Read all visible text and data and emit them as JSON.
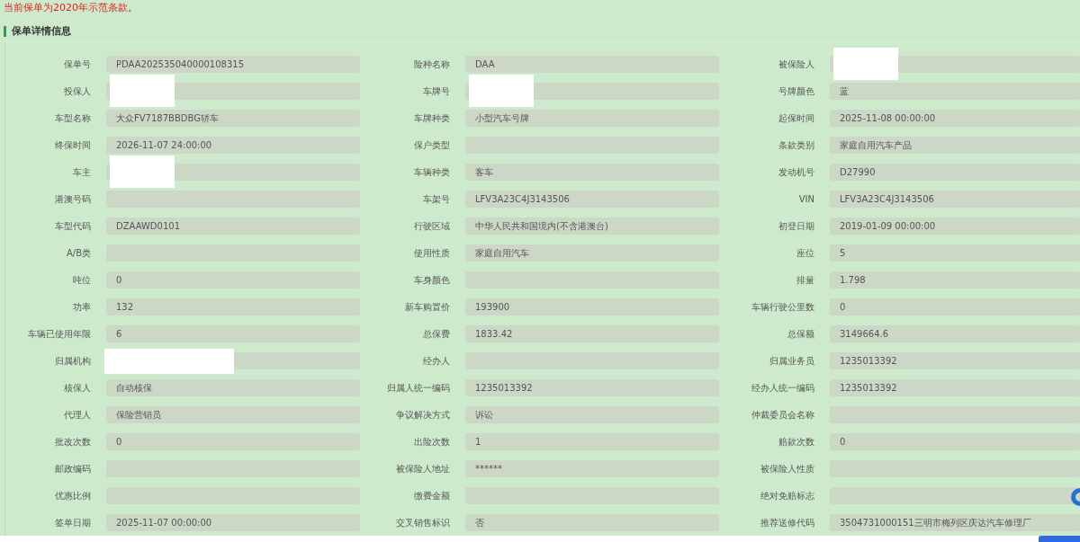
{
  "notice": "当前保单为2020年示范条款。",
  "section_title": "保单详情信息",
  "fields": [
    {
      "label": "保单号",
      "value": "PDAA202535040000108315"
    },
    {
      "label": "险种名称",
      "value": "DAA"
    },
    {
      "label": "被保险人",
      "redacted": true,
      "kind": "narrow"
    },
    {
      "label": "投保人",
      "redacted": true,
      "kind": "narrow"
    },
    {
      "label": "车牌号",
      "redacted": true,
      "kind": "narrow"
    },
    {
      "label": "号牌颜色",
      "value": "蓝"
    },
    {
      "label": "车型名称",
      "value": "大众FV7187BBDBG轿车"
    },
    {
      "label": "车牌种类",
      "value": "小型汽车号牌"
    },
    {
      "label": "起保时间",
      "value": "2025-11-08 00:00:00"
    },
    {
      "label": "终保时间",
      "value": "2026-11-07 24:00:00"
    },
    {
      "label": "保户类型"
    },
    {
      "label": "条款类别",
      "value": "家庭自用汽车产品"
    },
    {
      "label": "车主",
      "redacted": true,
      "kind": "narrow"
    },
    {
      "label": "车辆种类",
      "value": "客车"
    },
    {
      "label": "发动机号",
      "value": "D27990"
    },
    {
      "label": "港澳号码"
    },
    {
      "label": "车架号",
      "value": "LFV3A23C4J3143506"
    },
    {
      "label": "VIN",
      "value": "LFV3A23C4J3143506"
    },
    {
      "label": "车型代码",
      "value": "DZAAWD0101"
    },
    {
      "label": "行驶区域",
      "value": "中华人民共和国境内(不含港澳台)"
    },
    {
      "label": "初登日期",
      "value": "2019-01-09 00:00:00"
    },
    {
      "label": "A/B类"
    },
    {
      "label": "使用性质",
      "value": "家庭自用汽车"
    },
    {
      "label": "座位",
      "value": "5"
    },
    {
      "label": "吨位",
      "value": "0"
    },
    {
      "label": "车身颜色"
    },
    {
      "label": "排量",
      "value": "1.798"
    },
    {
      "label": "功率",
      "value": "132"
    },
    {
      "label": "新车购置价",
      "value": "193900"
    },
    {
      "label": "车辆行驶公里数",
      "value": "0"
    },
    {
      "label": "车辆已使用年限",
      "value": "6"
    },
    {
      "label": "总保费",
      "value": "1833.42"
    },
    {
      "label": "总保额",
      "value": "3149664.6"
    },
    {
      "label": "归属机构",
      "redacted": true,
      "kind": "wide"
    },
    {
      "label": "经办人"
    },
    {
      "label": "归属业务员",
      "value": "1235013392"
    },
    {
      "label": "核保人",
      "value": "自动核保"
    },
    {
      "label": "归属人统一编码",
      "value": "1235013392"
    },
    {
      "label": "经办人统一编码",
      "value": "1235013392"
    },
    {
      "label": "代理人",
      "value": "保险营销员"
    },
    {
      "label": "争议解决方式",
      "value": "诉讼"
    },
    {
      "label": "仲裁委员会名称"
    },
    {
      "label": "批改次数",
      "value": "0"
    },
    {
      "label": "出险次数",
      "value": "1"
    },
    {
      "label": "赔款次数",
      "value": "0"
    },
    {
      "label": "邮政编码"
    },
    {
      "label": "被保险人地址",
      "value": "******"
    },
    {
      "label": "被保险人性质"
    },
    {
      "label": "优惠比例"
    },
    {
      "label": "缴费金额"
    },
    {
      "label": "绝对免赔标志"
    },
    {
      "label": "签单日期",
      "value": "2025-11-07 00:00:00"
    },
    {
      "label": "交叉销售标识",
      "value": "否"
    },
    {
      "label": "推荐送修代码",
      "value": "3504731000151三明市梅列区庆达汽车修理厂"
    }
  ]
}
